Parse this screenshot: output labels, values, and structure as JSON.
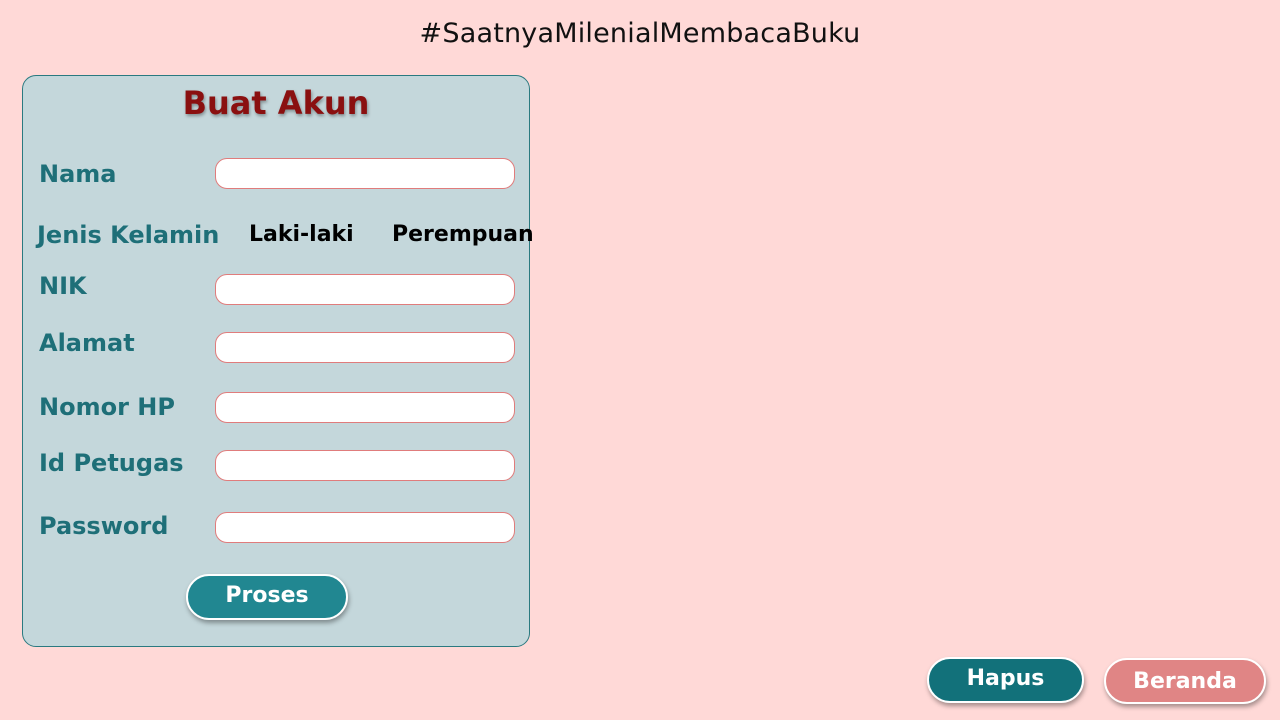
{
  "header": {
    "hashtag": "#SaatnyaMilenialMembacaBuku"
  },
  "form": {
    "title": "Buat Akun",
    "labels": {
      "nama": "Nama",
      "jenis_kelamin": "Jenis Kelamin",
      "nik": "NIK",
      "alamat": "Alamat",
      "nomor_hp": "Nomor HP",
      "id_petugas": "Id Petugas",
      "password": "Password"
    },
    "gender_options": [
      "Laki-laki",
      "Perempuan"
    ],
    "values": {
      "nama": "",
      "nik": "",
      "alamat": "",
      "nomor_hp": "",
      "id_petugas": "",
      "password": ""
    },
    "submit_label": "Proses"
  },
  "actions": {
    "hapus_label": "Hapus",
    "beranda_label": "Beranda"
  },
  "colors": {
    "background": "#ffd9d7",
    "card": "#c4d7db",
    "label": "#1e6f78",
    "title": "#8a1010",
    "primary_button": "#218791",
    "secondary_button": "#e08585"
  }
}
